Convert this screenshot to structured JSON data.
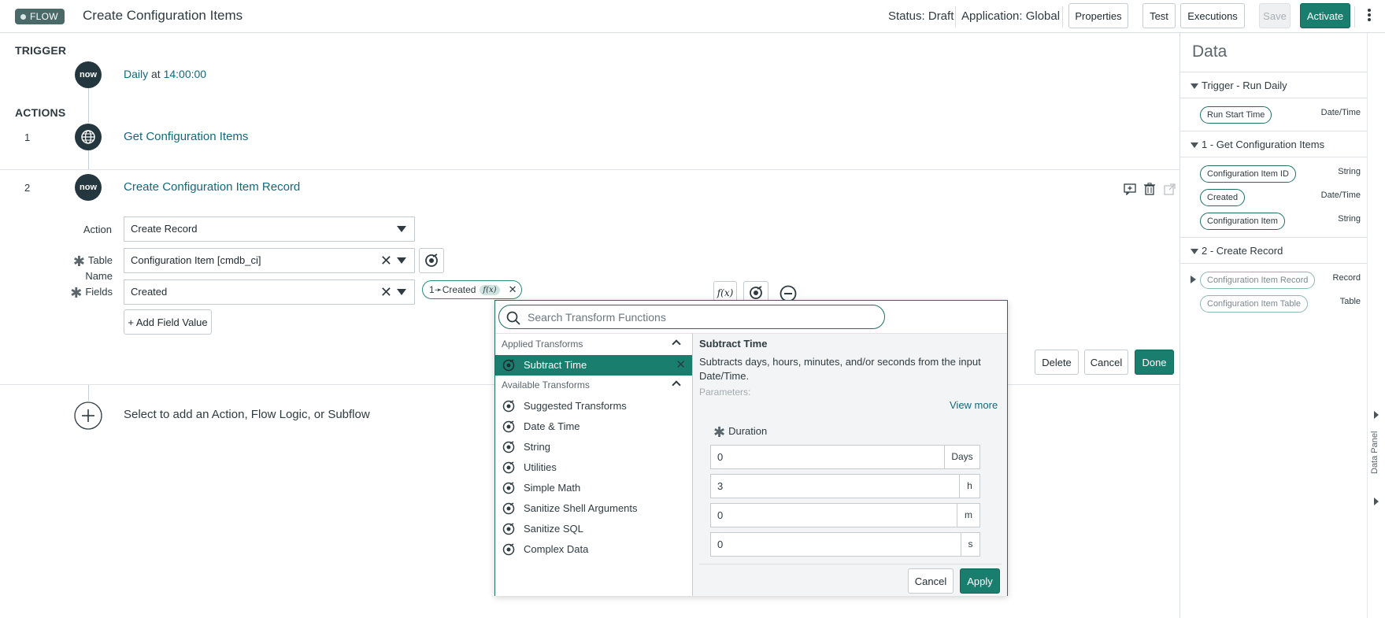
{
  "header": {
    "badge": "FLOW",
    "title": "Create Configuration Items",
    "status": "Status: Draft",
    "application": "Application: Global",
    "buttons": {
      "properties": "Properties",
      "test": "Test",
      "executions": "Executions",
      "save": "Save",
      "activate": "Activate"
    }
  },
  "trigger": {
    "section_label": "TRIGGER",
    "icon_text": "now",
    "schedule": "Daily",
    "at": "at",
    "time": "14:00:00"
  },
  "actions": {
    "section_label": "ACTIONS",
    "items": [
      {
        "num": "1",
        "label": "Get Configuration Items"
      },
      {
        "num": "2",
        "label": "Create Configuration Item Record",
        "icon_text": "now"
      }
    ],
    "add_label": "Select to add an Action, Flow Logic, or Subflow"
  },
  "form": {
    "action_label": "Action",
    "action_value": "Create Record",
    "table_label": "Table Name",
    "table_value": "Configuration Item [cmdb_ci]",
    "fields_label": "Fields",
    "fields_value": "Created",
    "pill_text": "1➛Created",
    "fx": "f(x)",
    "add_field": "+ Add Field Value",
    "delete": "Delete",
    "cancel": "Cancel",
    "done": "Done"
  },
  "data_panel": {
    "title": "Data",
    "sections": [
      {
        "label": "Trigger - Run Daily"
      },
      {
        "label": "1 - Get Configuration Items"
      },
      {
        "label": "2 - Create Record"
      }
    ],
    "pills": [
      {
        "label": "Run Start Time",
        "type": "Date/Time"
      },
      {
        "label": "Configuration Item ID",
        "type": "String"
      },
      {
        "label": "Created",
        "type": "Date/Time"
      },
      {
        "label": "Configuration Item",
        "type": "String"
      },
      {
        "label": "Configuration Item Record",
        "type": "Record"
      },
      {
        "label": "Configuration Item Table",
        "type": "Table"
      }
    ],
    "strip_label": "Data Panel"
  },
  "transform": {
    "search_placeholder": "Search Transform Functions",
    "applied_label": "Applied Transforms",
    "applied_item": "Subtract Time",
    "available_label": "Available Transforms",
    "available": [
      "Suggested Transforms",
      "Date & Time",
      "String",
      "Utilities",
      "Simple Math",
      "Sanitize Shell Arguments",
      "Sanitize SQL",
      "Complex Data"
    ],
    "detail": {
      "title": "Subtract Time",
      "description": "Subtracts days, hours, minutes, and/or seconds from the input Date/Time.",
      "parameters": "Parameters:",
      "view_more": "View more",
      "duration_label": "Duration",
      "inputs": [
        {
          "value": "0",
          "unit": "Days"
        },
        {
          "value": "3",
          "unit": "h"
        },
        {
          "value": "0",
          "unit": "m"
        },
        {
          "value": "0",
          "unit": "s"
        }
      ]
    },
    "cancel": "Cancel",
    "apply": "Apply"
  }
}
